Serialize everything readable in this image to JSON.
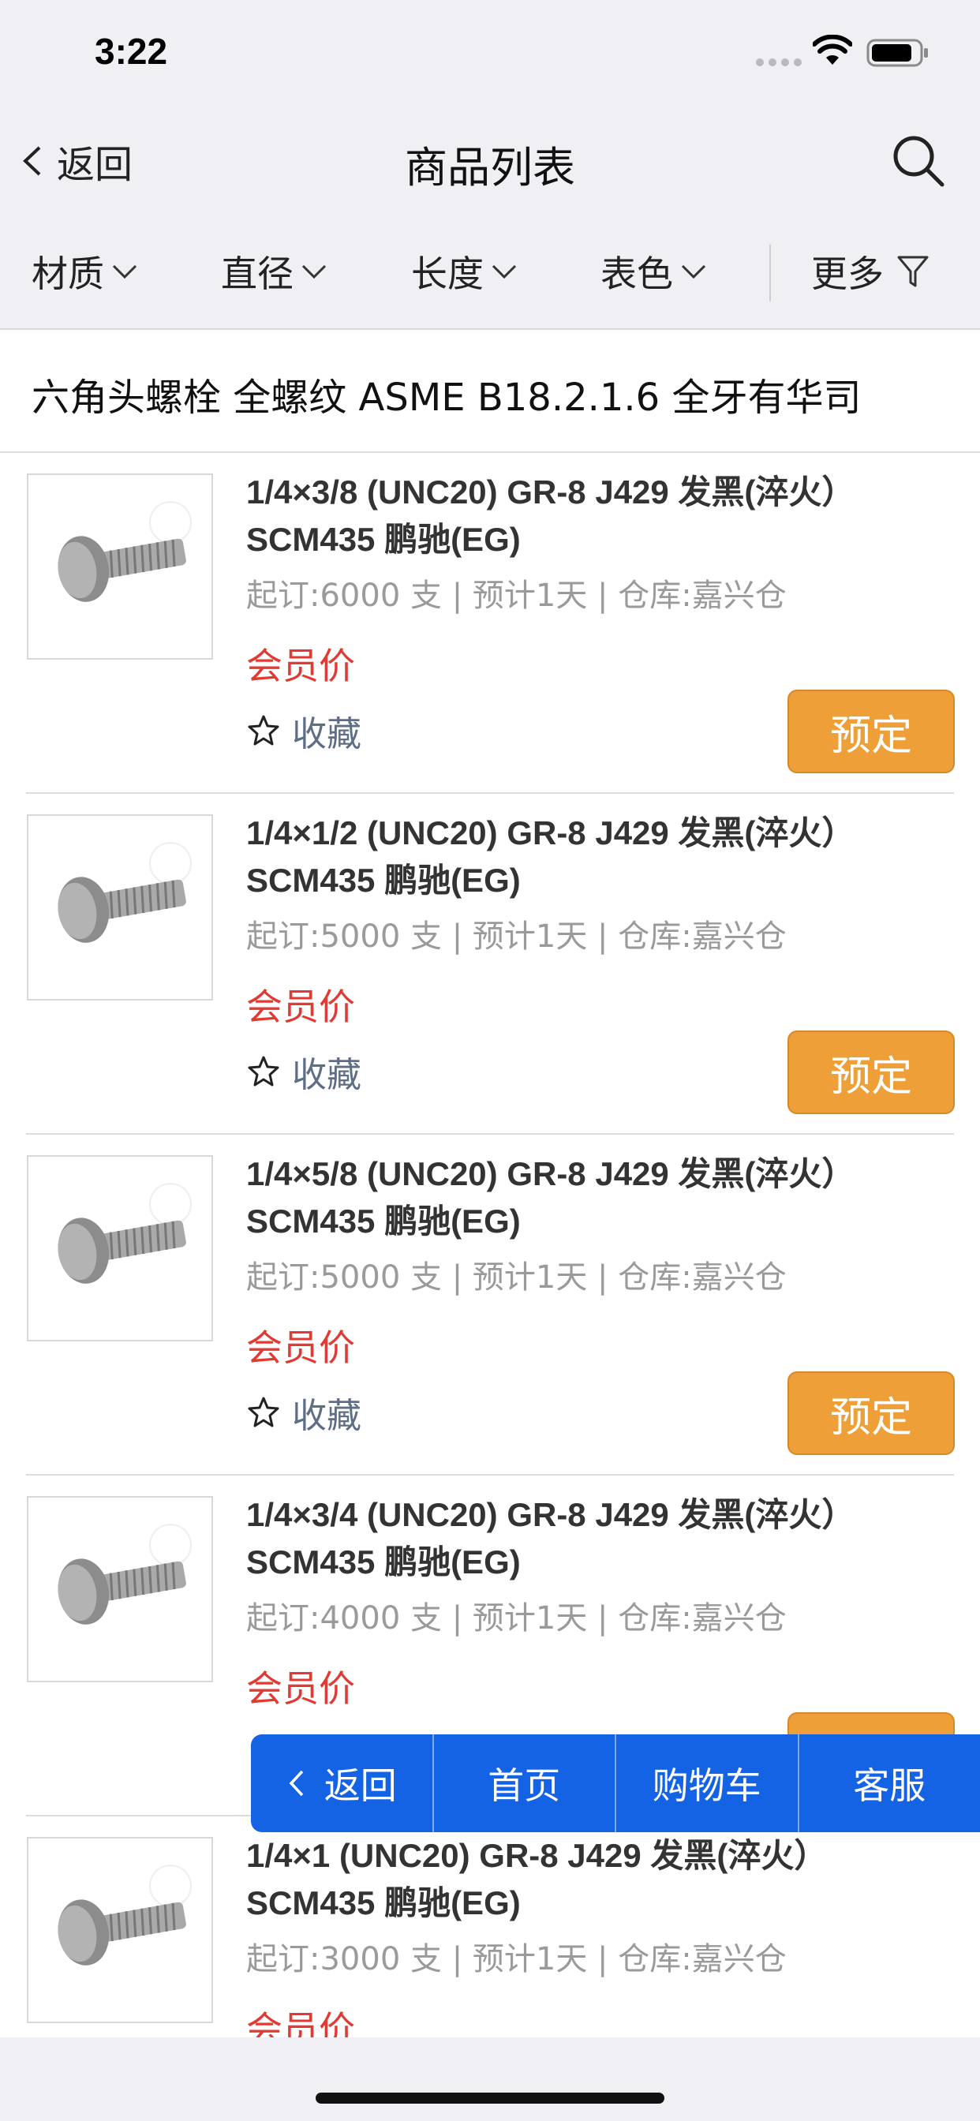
{
  "status_bar": {
    "time": "3:22"
  },
  "nav": {
    "back_label": "返回",
    "title": "商品列表"
  },
  "filters": {
    "material": "材质",
    "diameter": "直径",
    "length": "长度",
    "surface_color": "表色",
    "more": "更多"
  },
  "category": {
    "title": "六角头螺栓 全螺纹 ASME B18.2.1.6 全牙有华司"
  },
  "products": [
    {
      "name": "1/4×3/8 (UNC20) GR-8 J429 发黑(淬火）SCM435 鹏驰(EG)",
      "meta": "起订:6000 支 | 预计1天 | 仓库:嘉兴仓",
      "price": "会员价",
      "favorite": "收藏",
      "reserve": "预定"
    },
    {
      "name": "1/4×1/2 (UNC20) GR-8 J429 发黑(淬火）SCM435 鹏驰(EG)",
      "meta": "起订:5000 支 | 预计1天 | 仓库:嘉兴仓",
      "price": "会员价",
      "favorite": "收藏",
      "reserve": "预定"
    },
    {
      "name": "1/4×5/8 (UNC20) GR-8 J429 发黑(淬火）SCM435 鹏驰(EG)",
      "meta": "起订:5000 支 | 预计1天 | 仓库:嘉兴仓",
      "price": "会员价",
      "favorite": "收藏",
      "reserve": "预定"
    },
    {
      "name": "1/4×3/4 (UNC20) GR-8 J429 发黑(淬火）SCM435 鹏驰(EG)",
      "meta": "起订:4000 支 | 预计1天 | 仓库:嘉兴仓",
      "price": "会员价"
    },
    {
      "name": "1/4×1 (UNC20) GR-8 J429 发黑(淬火）SCM435 鹏驰(EG)",
      "meta": "起订:3000 支 | 预计1天 | 仓库:嘉兴仓",
      "price": "会员价"
    }
  ],
  "float_nav": {
    "back": "返回",
    "home": "首页",
    "cart": "购物车",
    "service": "客服"
  },
  "colors": {
    "accent_blue": "#1463e4",
    "reserve_orange": "#ef9f37",
    "price_red": "#e03a32",
    "header_bg": "#efeff4"
  }
}
